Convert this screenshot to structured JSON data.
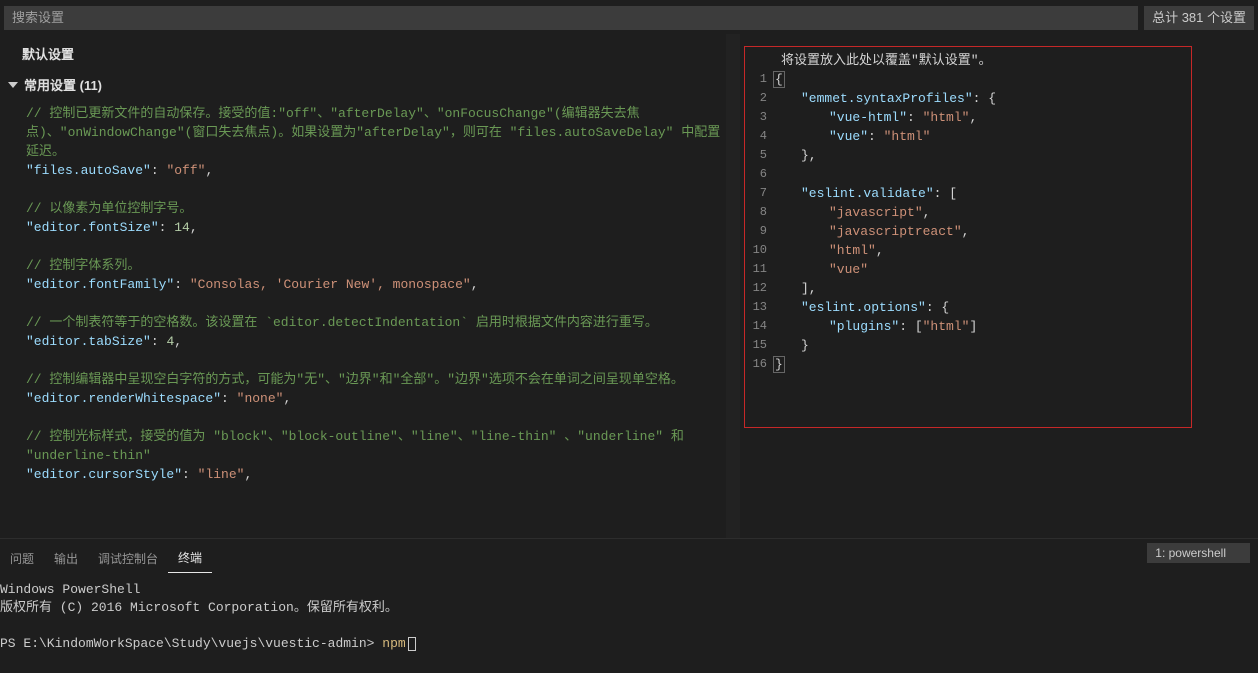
{
  "search": {
    "placeholder": "搜索设置"
  },
  "count_badge": "总计 381 个设置",
  "default_title": "默认设置",
  "group_title": "常用设置 (11)",
  "left_code": {
    "c1": "// 控制已更新文件的自动保存。接受的值:\"off\"、\"afterDelay\"、\"onFocusChange\"(编辑器失去焦点)、\"onWindowChange\"(窗口失去焦点)。如果设置为\"afterDelay\"，则可在 \"files.autoSaveDelay\" 中配置延迟。",
    "k1": "\"files.autoSave\"",
    "v1": "\"off\"",
    "c2": "// 以像素为单位控制字号。",
    "k2": "\"editor.fontSize\"",
    "v2": "14",
    "c3": "// 控制字体系列。",
    "k3": "\"editor.fontFamily\"",
    "v3": "\"Consolas, 'Courier New', monospace\"",
    "c4": "// 一个制表符等于的空格数。该设置在 `editor.detectIndentation` 启用时根据文件内容进行重写。",
    "k4": "\"editor.tabSize\"",
    "v4": "4",
    "c5": "// 控制编辑器中呈现空白字符的方式，可能为\"无\"、\"边界\"和\"全部\"。\"边界\"选项不会在单词之间呈现单空格。",
    "k5": "\"editor.renderWhitespace\"",
    "v5": "\"none\"",
    "c6": "// 控制光标样式，接受的值为 \"block\"、\"block-outline\"、\"line\"、\"line-thin\" 、\"underline\" 和 \"underline-thin\"",
    "k6": "\"editor.cursorStyle\"",
    "v6": "\"line\""
  },
  "right": {
    "hint": "将设置放入此处以覆盖\"默认设置\"。",
    "lines": {
      "l1": "{",
      "l2k": "\"emmet.syntaxProfiles\"",
      "l2r": ": {",
      "l3k": "\"vue-html\"",
      "l3v": "\"html\"",
      "l4k": "\"vue\"",
      "l4v": "\"html\"",
      "l5": "},",
      "l7k": "\"eslint.validate\"",
      "l7r": ": [",
      "l8": "\"javascript\"",
      "l9": "\"javascriptreact\"",
      "l10": "\"html\"",
      "l11": "\"vue\"",
      "l12": "],",
      "l13k": "\"eslint.options\"",
      "l13r": ": {",
      "l14k": "\"plugins\"",
      "l14r": ": [",
      "l14v": "\"html\"",
      "l14e": "]",
      "l15": "}",
      "l16": "}"
    },
    "gutter": [
      "1",
      "2",
      "3",
      "4",
      "5",
      "6",
      "7",
      "8",
      "9",
      "10",
      "11",
      "12",
      "13",
      "14",
      "15",
      "16"
    ]
  },
  "panel": {
    "tabs": {
      "problems": "问题",
      "output": "输出",
      "debug": "调试控制台",
      "terminal": "终端"
    },
    "term_select": "1: powershell",
    "term": {
      "l1": "Windows PowerShell",
      "l2": "版权所有 (C) 2016 Microsoft Corporation。保留所有权利。",
      "prompt": "PS E:\\KindomWorkSpace\\Study\\vuejs\\vuestic-admin> ",
      "cmd": "npm"
    }
  }
}
